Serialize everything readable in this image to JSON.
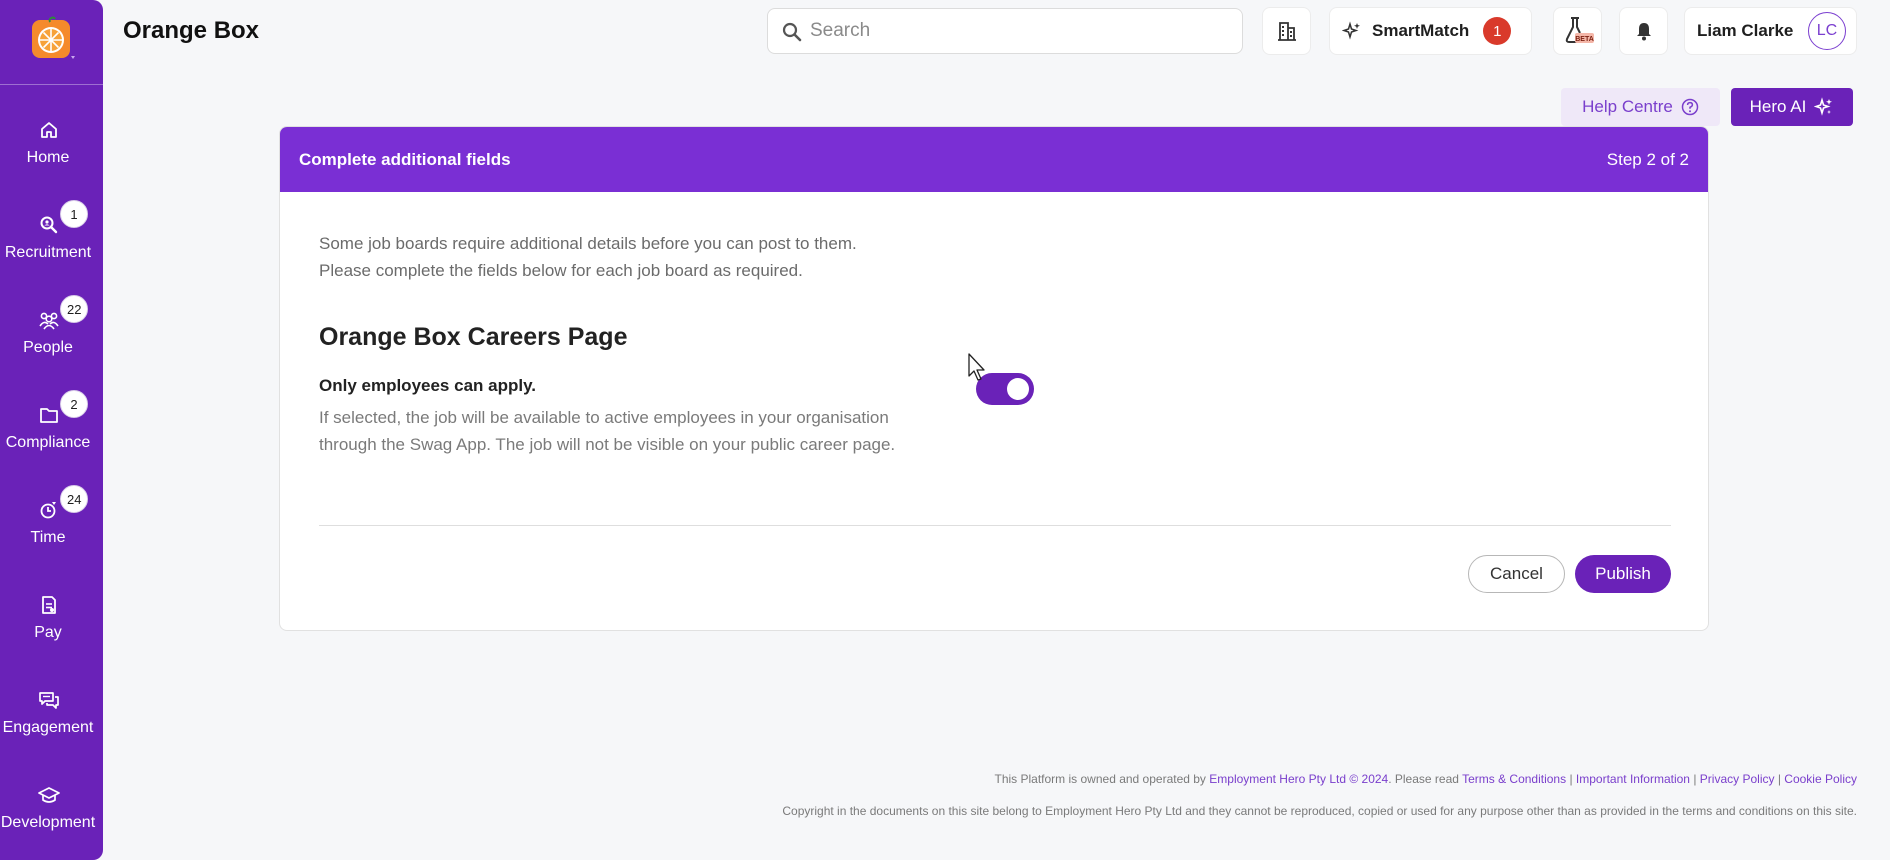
{
  "app": {
    "title": "Orange Box"
  },
  "header": {
    "search_placeholder": "Search",
    "smartmatch_label": "SmartMatch",
    "smartmatch_count": "1",
    "beta_tag": "BETA",
    "user_name": "Liam Clarke",
    "user_initials": "LC"
  },
  "sidebar": {
    "items": [
      {
        "label": "Home",
        "badge": ""
      },
      {
        "label": "Recruitment",
        "badge": "1"
      },
      {
        "label": "People",
        "badge": "22"
      },
      {
        "label": "Compliance",
        "badge": "2"
      },
      {
        "label": "Time",
        "badge": "24"
      },
      {
        "label": "Pay",
        "badge": ""
      },
      {
        "label": "Engagement",
        "badge": ""
      },
      {
        "label": "Development",
        "badge": ""
      }
    ]
  },
  "actions": {
    "help_label": "Help Centre",
    "heroai_label": "Hero AI"
  },
  "card": {
    "title": "Complete additional fields",
    "step": "Step 2 of 2",
    "intro_line1": "Some job boards require additional details before you can post to them.",
    "intro_line2": "Please complete the fields below for each job board as required.",
    "section_title": "Orange Box Careers Page",
    "option_label": "Only employees can apply.",
    "option_desc_line1": "If selected, the job will be available to active employees in your organisation",
    "option_desc_line2": "through the Swag App. The job will not be visible on your public career page.",
    "toggle_on": true,
    "cancel_label": "Cancel",
    "publish_label": "Publish"
  },
  "footer": {
    "line1_prefix": "This Platform is owned and operated by",
    "company_link": "Employment Hero Pty Ltd © 2024",
    "please_read": ". Please read",
    "links": [
      "Terms & Conditions",
      "Important Information",
      "Privacy Policy",
      "Cookie Policy"
    ],
    "line2": "Copyright in the documents on this site belong to Employment Hero Pty Ltd and they cannot be reproduced, copied or used for any purpose other than as provided in the terms and conditions on this site."
  },
  "colors": {
    "brand_purple": "#6a22b8",
    "header_purple": "#7a2fd4",
    "badge_red": "#d93a2b",
    "logo_orange": "#f58a2c"
  }
}
